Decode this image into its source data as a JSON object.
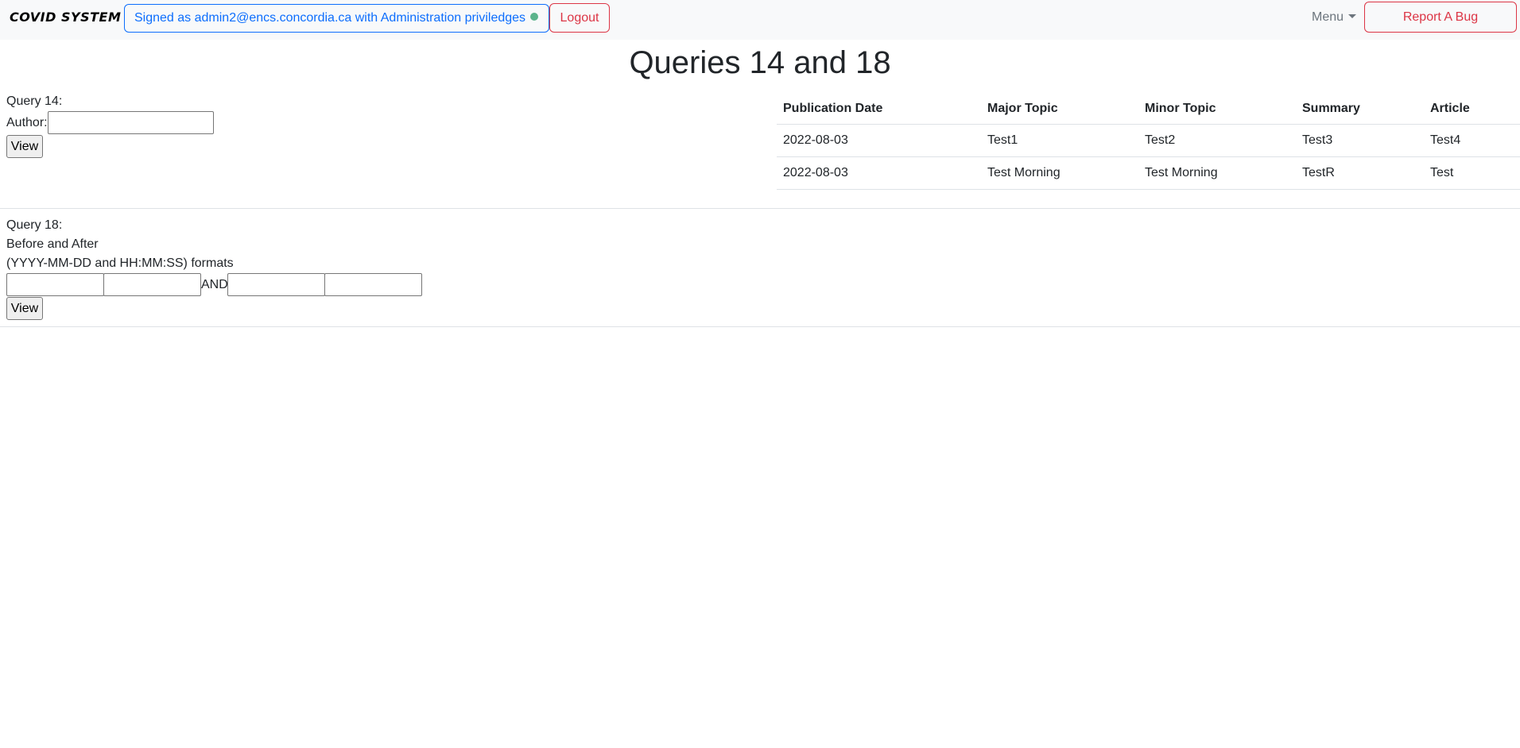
{
  "navbar": {
    "brand": "COVID SYSTEM",
    "signed_in_text": "Signed as admin2@encs.concordia.ca with Administration priviledges",
    "logout_label": "Logout",
    "menu_label": "Menu",
    "report_bug_label": "Report A Bug",
    "status_color": "#5cb48c"
  },
  "page": {
    "title": "Queries 14 and 18"
  },
  "query14": {
    "label": "Query 14:",
    "author_label": "Author:",
    "author_value": "",
    "view_label": "View"
  },
  "results": {
    "columns": [
      "Publication Date",
      "Major Topic",
      "Minor Topic",
      "Summary",
      "Article"
    ],
    "rows": [
      [
        "2022-08-03",
        "Test1",
        "Test2",
        "Test3",
        "Test4"
      ],
      [
        "2022-08-03",
        "Test Morning",
        "Test Morning",
        "TestR",
        "Test"
      ]
    ]
  },
  "query18": {
    "label": "Query 18:",
    "before_after": "Before and After",
    "formats_hint": "(YYYY-MM-DD and HH:MM:SS) formats",
    "and_label": "AND",
    "before_date": "",
    "before_time": "",
    "after_date": "",
    "after_time": "",
    "view_label": "View"
  },
  "colors": {
    "primary": "#0d6efd",
    "danger": "#dc3545",
    "navbar_bg": "#f8f9fa"
  }
}
